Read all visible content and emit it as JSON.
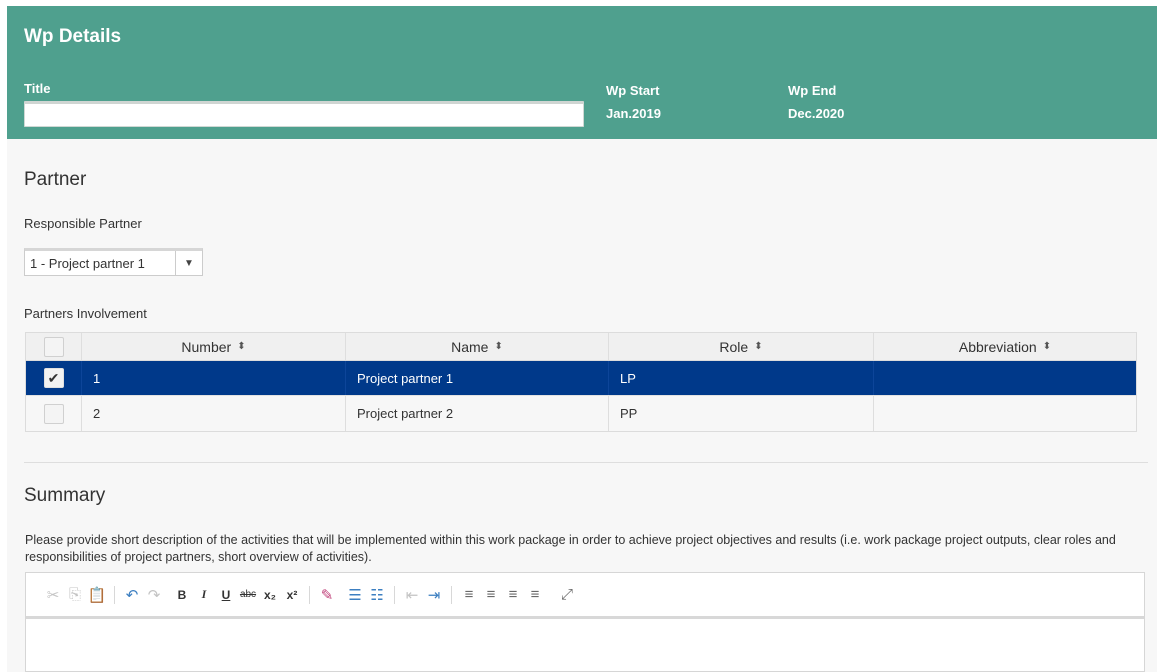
{
  "header": {
    "title": "Wp Details",
    "title_label": "Title",
    "title_value": "",
    "wp_start_label": "Wp Start",
    "wp_start_value": "Jan.2019",
    "wp_end_label": "Wp End",
    "wp_end_value": "Dec.2020"
  },
  "partner": {
    "section_title": "Partner",
    "responsible_label": "Responsible Partner",
    "responsible_value": "1 - Project partner 1",
    "involvement_label": "Partners Involvement",
    "table": {
      "columns": [
        "Number",
        "Name",
        "Role",
        "Abbreviation"
      ],
      "rows": [
        {
          "number": "1",
          "name": "Project partner 1",
          "role": "LP",
          "abbreviation": "",
          "checked": true
        },
        {
          "number": "2",
          "name": "Project partner 2",
          "role": "PP",
          "abbreviation": "",
          "checked": false
        }
      ]
    }
  },
  "summary": {
    "section_title": "Summary",
    "description": "Please provide short description of the activities that will be implemented within this work package in order to achieve project objectives and results (i.e. work package project outputs, clear roles and responsibilities of project partners, short overview of activities).",
    "toolbar": {
      "cut": "✂",
      "copy": "⎘",
      "paste_text": "📋",
      "undo": "↶",
      "redo": "↷",
      "bold": "B",
      "italic": "I",
      "underline": "U",
      "strike": "abc",
      "subscript": "x₂",
      "superscript": "x²",
      "remove_format": "✎",
      "numbered_list": "☰",
      "bulleted_list": "☷",
      "outdent": "⇤",
      "indent": "⇥",
      "align_left": "≡",
      "align_center": "≡",
      "align_right": "≡",
      "justify": "≡",
      "maximize": "⤢"
    }
  },
  "colors": {
    "header_bg": "#4fa08e",
    "selected_row_bg": "#00398a",
    "page_bg": "#f7f7f7"
  }
}
